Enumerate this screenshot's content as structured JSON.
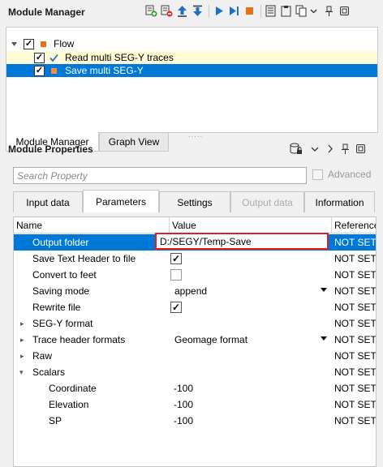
{
  "module_manager": {
    "title": "Module Manager",
    "toolbar_icons": [
      "add-module-icon",
      "remove-module-icon",
      "move-up-icon",
      "move-down-icon",
      "run-icon",
      "run-step-icon",
      "stop-icon",
      "list-icon",
      "clipboard-icon",
      "copy-icon",
      "dropdown-icon",
      "pin-icon",
      "maximize-icon"
    ],
    "tree": [
      {
        "label": "Flow",
        "checked": true,
        "level": 0
      },
      {
        "label": "Read multi SEG-Y traces",
        "checked": true,
        "level": 1,
        "status": "ok"
      },
      {
        "label": "Save multi SEG-Y",
        "checked": true,
        "level": 1,
        "selected": true
      }
    ],
    "tabs": [
      "Module Manager",
      "Graph View"
    ],
    "active_tab": "Module Manager"
  },
  "module_properties": {
    "title": "Module Properties",
    "search_placeholder": "Search Property",
    "advanced_label": "Advanced",
    "tabs": [
      "Input data",
      "Parameters",
      "Settings",
      "Output data",
      "Information"
    ],
    "active_tab": "Parameters",
    "columns": [
      "Name",
      "Value",
      "Reference"
    ],
    "rows": [
      {
        "name": "Output folder",
        "value": "D:/SEGY/Temp-Save",
        "ref": "NOT SET"
      },
      {
        "name": "Save Text Header to file",
        "value": "✓",
        "ref": "NOT SET"
      },
      {
        "name": "Convert to feet",
        "value": "",
        "ref": "NOT SET"
      },
      {
        "name": "Saving mode",
        "value": "append",
        "ref": "NOT SET"
      },
      {
        "name": "Rewrite file",
        "value": "✓",
        "ref": "NOT SET"
      },
      {
        "name": "SEG-Y format",
        "value": "",
        "ref": "NOT SET"
      },
      {
        "name": "Trace header formats",
        "value": "Geomage format",
        "ref": "NOT SET"
      },
      {
        "name": "Raw",
        "value": "",
        "ref": "NOT SET"
      },
      {
        "name": "Scalars",
        "value": "",
        "ref": "NOT SET"
      },
      {
        "name": "Coordinate",
        "value": "-100",
        "ref": "NOT SET"
      },
      {
        "name": "Elevation",
        "value": "-100",
        "ref": "NOT SET"
      },
      {
        "name": "SP",
        "value": "-100",
        "ref": "NOT SET"
      }
    ]
  },
  "colors": {
    "selection": "#0078d7",
    "highlight_row": "#fffbd6",
    "accent_orange": "#e8701a",
    "edit_border": "#e02020"
  }
}
